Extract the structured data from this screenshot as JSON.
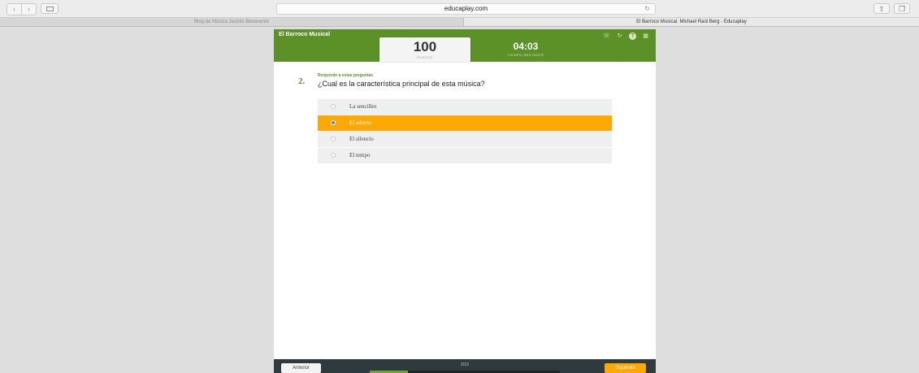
{
  "browser": {
    "url": "educaplay.com",
    "tabs": [
      {
        "title": "Blog de Música Jacinto Benavente"
      },
      {
        "title": "El Barroco Musical. Michael Raúl Berg - Educaplay"
      }
    ]
  },
  "activity": {
    "title": "El Barroco Musical",
    "points": "100",
    "points_label": "PUNTOS",
    "timer": "04:03",
    "timer_label": "TIEMPO RESTANTE",
    "question_number": "2.",
    "instruction": "Responde a estas preguntas",
    "question": "¿Cual es la característica principal de esta música?",
    "answers": [
      {
        "label": "La sencillez",
        "selected": false
      },
      {
        "label": "El adorno",
        "selected": true
      },
      {
        "label": "El silencio",
        "selected": false
      },
      {
        "label": "El tempo",
        "selected": false
      }
    ],
    "footer": {
      "prev_label": "Anterior",
      "next_label": "Siguiente",
      "counter": "2/10",
      "progress_fraction": 0.2
    }
  },
  "colors": {
    "header_green": "#5c9128",
    "selected_orange": "#ffa800",
    "footer_dark": "#2f3a3f"
  }
}
